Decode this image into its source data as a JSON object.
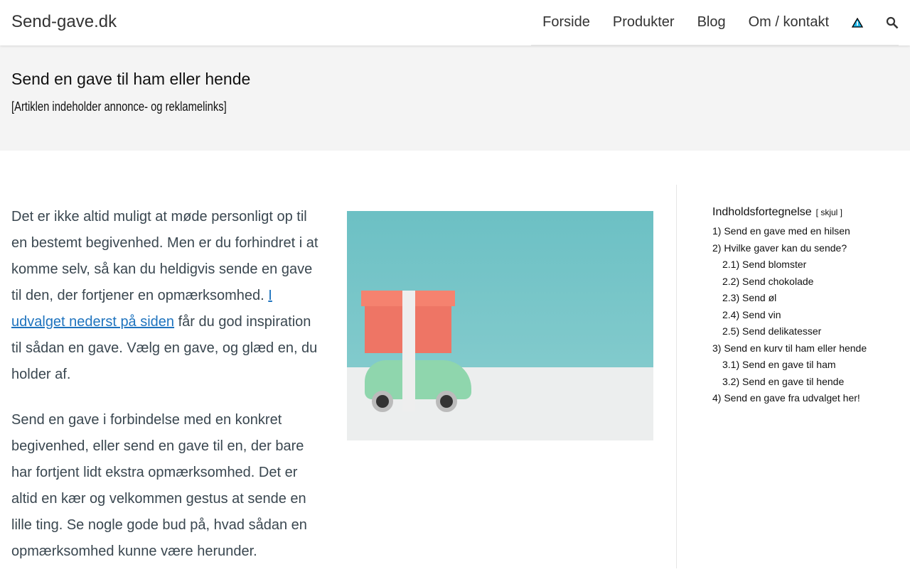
{
  "header": {
    "logo": "Send-gave.dk",
    "nav": [
      "Forside",
      "Produkter",
      "Blog",
      "Om / kontakt"
    ],
    "icons": [
      "warning-icon",
      "search-icon"
    ]
  },
  "title": {
    "heading": "Send en gave til ham eller hende",
    "disclaimer": "[Artiklen indeholder annonce- og reklamelinks]"
  },
  "article": {
    "p1_before": "Det er ikke altid muligt at møde personligt op til en bestemt begivenhed. Men er du forhindret i at komme selv, så kan du heldigvis sende en gave til den, der fortjener en opmærksomhed. ",
    "p1_link": "I udvalget nederst på siden",
    "p1_after": " får du god inspiration til sådan en gave. Vælg en gave, og glæd en, du holder af.",
    "p2": "Send en gave i forbindelse med en konkret begivenhed, eller send en gave til en, der bare har fortjent lidt ekstra opmærksomhed. Det er altid en kær og velkommen gestus at sende en lille ting. Se nogle gode bud på, hvad sådan en opmærksomhed kunne være herunder."
  },
  "toc": {
    "title": "Indholdsfortegnelse",
    "hide": "[ skjul ]",
    "items": [
      "1) Send en gave med en hilsen",
      "2) Hvilke gaver kan du sende?",
      "2.1) Send blomster",
      "2.2) Send chokolade",
      "2.3) Send øl",
      "2.4) Send vin",
      "2.5) Send delikatesser",
      "3) Send en kurv til ham eller hende",
      "3.1) Send en gave til ham",
      "3.2) Send en gave til hende",
      "4) Send en gave fra udvalget her!"
    ]
  }
}
